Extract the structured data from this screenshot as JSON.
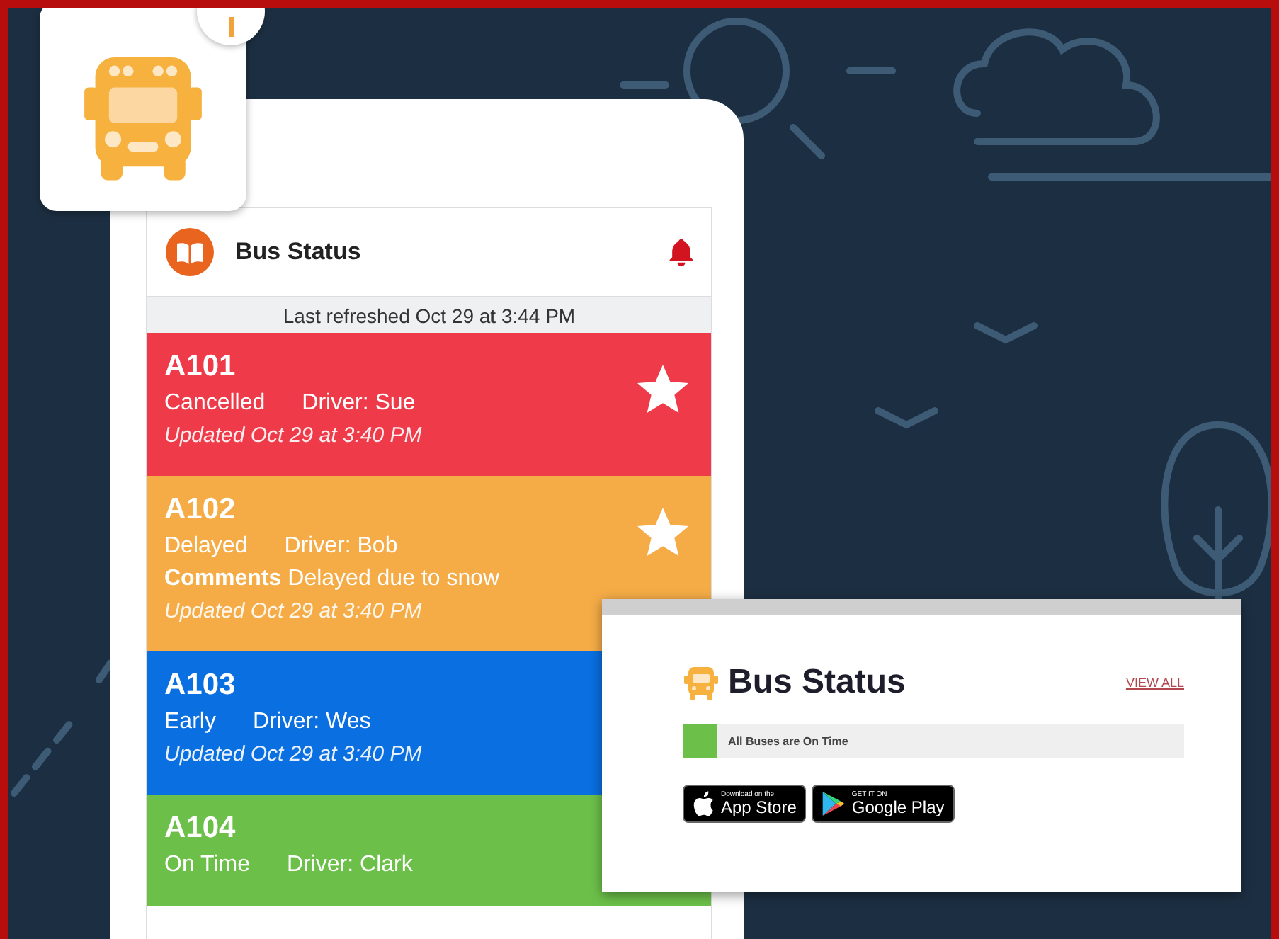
{
  "app": {
    "title": "Bus Status",
    "refreshed": "Last refreshed Oct 29 at 3:44 PM",
    "buses": [
      {
        "code": "A101",
        "status": "Cancelled",
        "driver": "Driver: Sue",
        "updated": "Updated Oct 29 at 3:40 PM",
        "starred": true,
        "color": "#ef3b49"
      },
      {
        "code": "A102",
        "status": "Delayed",
        "driver": "Driver: Bob",
        "comments": "**Comments** Delayed due to snow",
        "updated": "Updated Oct 29 at 3:40 PM",
        "starred": true,
        "color": "#f5ac47"
      },
      {
        "code": "A103",
        "status": "Early",
        "driver": "Driver: Wes",
        "updated": "Updated Oct 29 at 3:40 PM",
        "color": "#0a6fe0"
      },
      {
        "code": "A104",
        "status": "On Time",
        "driver": "Driver: Clark",
        "color": "#6cc04a"
      }
    ]
  },
  "widget": {
    "title": "Bus Status",
    "link": "VIEW ALL",
    "summary": {
      "text": "All Buses are On Time",
      "color": "#6cc04a"
    },
    "badges": [
      {
        "kind": "apple",
        "small": "Download on the",
        "big": "App Store"
      },
      {
        "kind": "google",
        "small": "GET IT ON",
        "big": "Google Play"
      }
    ]
  }
}
